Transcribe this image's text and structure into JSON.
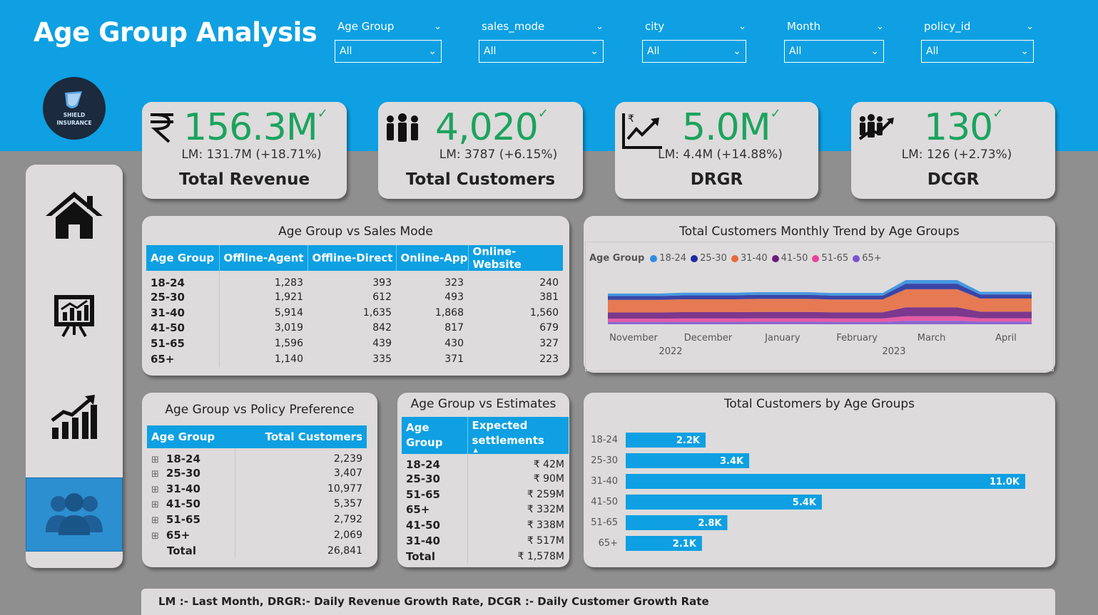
{
  "header": {
    "title": "Age Group Analysis"
  },
  "slicers": [
    {
      "label": "Age Group",
      "value": "All"
    },
    {
      "label": "sales_mode",
      "value": "All"
    },
    {
      "label": "city",
      "value": "All"
    },
    {
      "label": "Month",
      "value": "All"
    },
    {
      "label": "policy_id",
      "value": "All"
    }
  ],
  "logo": {
    "line1": "SHIELD",
    "line2": "INSURANCE"
  },
  "nav": [
    {
      "icon": "home-icon",
      "active": false
    },
    {
      "icon": "presentation-chart-icon",
      "active": false
    },
    {
      "icon": "growth-chart-icon",
      "active": false
    },
    {
      "icon": "user-group-icon",
      "active": true
    }
  ],
  "kpis": [
    {
      "value": "156.3M",
      "lm": "LM: 131.7M (+18.71%)",
      "name": "Total Revenue",
      "icon": "rupee-icon"
    },
    {
      "value": "4,020",
      "lm": "LM: 3787 (+6.15%)",
      "name": "Total Customers",
      "icon": "people-icon"
    },
    {
      "value": "5.0M",
      "lm": "LM: 4.4M (+14.88%)",
      "name": "DRGR",
      "icon": "revenue-growth-icon"
    },
    {
      "value": "130",
      "lm": "LM: 126 (+2.73%)",
      "name": "DCGR",
      "icon": "customer-growth-icon"
    }
  ],
  "sales_mode_table": {
    "title": "Age Group vs Sales Mode",
    "headers": [
      "Age Group",
      "Offline-Agent",
      "Offline-Direct",
      "Online-App",
      "Online-Website"
    ],
    "rows": [
      [
        "18-24",
        "1,283",
        "393",
        "323",
        "240"
      ],
      [
        "25-30",
        "1,921",
        "612",
        "493",
        "381"
      ],
      [
        "31-40",
        "5,914",
        "1,635",
        "1,868",
        "1,560"
      ],
      [
        "41-50",
        "3,019",
        "842",
        "817",
        "679"
      ],
      [
        "51-65",
        "1,596",
        "439",
        "430",
        "327"
      ],
      [
        "65+",
        "1,140",
        "335",
        "371",
        "223"
      ]
    ]
  },
  "policy_table": {
    "title": "Age Group vs Policy Preference",
    "headers": [
      "Age Group",
      "Total Customers"
    ],
    "rows": [
      [
        "18-24",
        "2,239"
      ],
      [
        "25-30",
        "3,407"
      ],
      [
        "31-40",
        "10,977"
      ],
      [
        "41-50",
        "5,357"
      ],
      [
        "51-65",
        "2,792"
      ],
      [
        "65+",
        "2,069"
      ]
    ],
    "total": [
      "Total",
      "26,841"
    ]
  },
  "estimates_table": {
    "title": "Age Group vs Estimates",
    "header_age_1": "Age",
    "header_age_2": "Group",
    "header_est_1": "Expected",
    "header_est_2": "settlements",
    "rows": [
      [
        "18-24",
        "₹ 42M"
      ],
      [
        "25-30",
        "₹ 90M"
      ],
      [
        "51-65",
        "₹ 259M"
      ],
      [
        "65+",
        "₹ 332M"
      ],
      [
        "41-50",
        "₹ 338M"
      ],
      [
        "31-40",
        "₹ 517M"
      ]
    ],
    "total": [
      "Total",
      "₹ 1,578M"
    ]
  },
  "trend": {
    "title": "Total Customers Monthly Trend by Age Groups",
    "legend_title": "Age Group",
    "years": [
      "2022",
      "2023"
    ]
  },
  "bars": {
    "title": "Total Customers by Age Groups"
  },
  "chart_data": [
    {
      "type": "area",
      "title": "Total Customers Monthly Trend by Age Groups",
      "x": [
        "November",
        "December",
        "January",
        "February",
        "March",
        "April"
      ],
      "legend_title": "Age Group",
      "legend_position": "top-left",
      "series": [
        {
          "name": "18-24",
          "color": "#2b8de0",
          "values": [
            290,
            300,
            310,
            300,
            420,
            310
          ]
        },
        {
          "name": "25-30",
          "color": "#1f2a9e",
          "values": [
            440,
            450,
            460,
            450,
            640,
            460
          ]
        },
        {
          "name": "31-40",
          "color": "#e8693b",
          "values": [
            1440,
            1480,
            1500,
            1470,
            2080,
            1520
          ]
        },
        {
          "name": "41-50",
          "color": "#6b1b7f",
          "values": [
            710,
            730,
            740,
            720,
            1020,
            750
          ]
        },
        {
          "name": "51-65",
          "color": "#e7449a",
          "values": [
            370,
            380,
            390,
            380,
            530,
            390
          ]
        },
        {
          "name": "65+",
          "color": "#7b52d1",
          "values": [
            280,
            280,
            290,
            280,
            390,
            300
          ]
        }
      ]
    },
    {
      "type": "bar",
      "orientation": "horizontal",
      "title": "Total Customers by Age Groups",
      "categories": [
        "18-24",
        "25-30",
        "31-40",
        "41-50",
        "51-65",
        "65+"
      ],
      "values": [
        2.2,
        3.4,
        11.0,
        5.4,
        2.8,
        2.1
      ],
      "labels": [
        "2.2K",
        "3.4K",
        "11.0K",
        "5.4K",
        "2.8K",
        "2.1K"
      ],
      "unit": "K",
      "color": "#0ea0e2"
    }
  ],
  "footer": {
    "text": "LM :- Last Month, DRGR:- Daily Revenue Growth Rate, DCGR :- Daily Customer Growth Rate"
  },
  "colors": {
    "brand": "#0ea0e2",
    "kpi_value": "#1ca35e",
    "card": "#dddbdb",
    "background": "#8f8f8f"
  }
}
